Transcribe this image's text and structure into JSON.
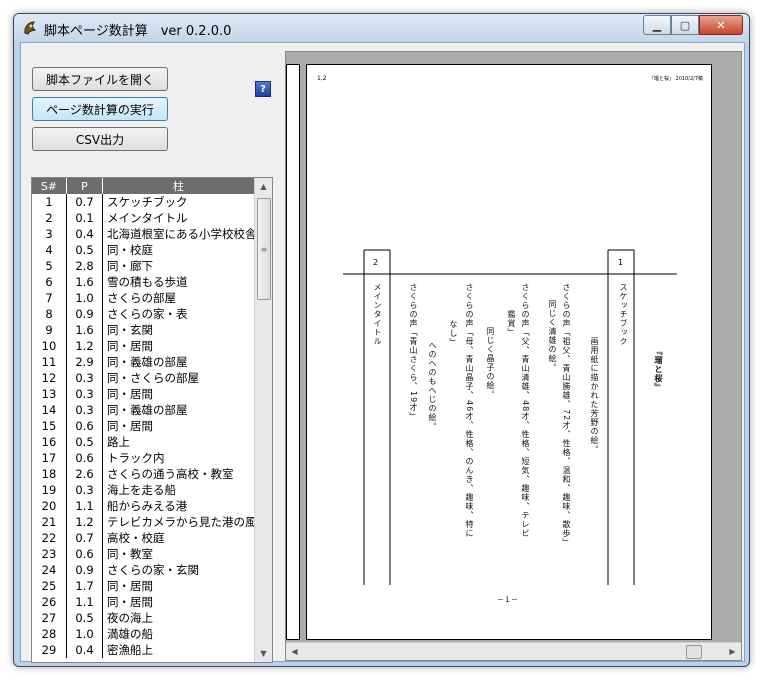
{
  "window": {
    "title": "脚本ページ数計算　ver 0.2.0.0"
  },
  "toolbar": {
    "open_label": "脚本ファイルを開く",
    "calc_label": "ページ数計算の実行",
    "csv_label": "CSV出力",
    "help_label": "?"
  },
  "table": {
    "headers": [
      "S#",
      "P",
      "柱"
    ],
    "rows": [
      [
        "1",
        "0.7",
        "スケッチブック"
      ],
      [
        "2",
        "0.1",
        "メインタイトル"
      ],
      [
        "3",
        "0.4",
        "北海道根室にある小学校校舎"
      ],
      [
        "4",
        "0.5",
        "同・校庭"
      ],
      [
        "5",
        "2.8",
        "同・廊下"
      ],
      [
        "6",
        "1.6",
        "雪の積もる歩道"
      ],
      [
        "7",
        "1.0",
        "さくらの部屋"
      ],
      [
        "8",
        "0.9",
        "さくらの家・表"
      ],
      [
        "9",
        "1.6",
        "同・玄関"
      ],
      [
        "10",
        "1.2",
        "同・居間"
      ],
      [
        "11",
        "2.9",
        "同・義雄の部屋"
      ],
      [
        "12",
        "0.3",
        "同・さくらの部屋"
      ],
      [
        "13",
        "0.3",
        "同・居間"
      ],
      [
        "14",
        "0.3",
        "同・義雄の部屋"
      ],
      [
        "15",
        "0.6",
        "同・居間"
      ],
      [
        "16",
        "0.5",
        "路上"
      ],
      [
        "17",
        "0.6",
        "トラック内"
      ],
      [
        "18",
        "2.6",
        "さくらの通う高校・教室"
      ],
      [
        "19",
        "0.3",
        "海上を走る船"
      ],
      [
        "20",
        "1.1",
        "船からみえる港"
      ],
      [
        "21",
        "1.2",
        "テレビカメラから見た港の風景"
      ],
      [
        "22",
        "0.7",
        "高校・校庭"
      ],
      [
        "23",
        "0.6",
        "同・教室"
      ],
      [
        "24",
        "0.9",
        "さくらの家・玄関"
      ],
      [
        "25",
        "1.7",
        "同・居間"
      ],
      [
        "26",
        "1.1",
        "同・居間"
      ],
      [
        "27",
        "0.5",
        "夜の海上"
      ],
      [
        "28",
        "1.0",
        "満雄の船"
      ],
      [
        "29",
        "0.4",
        "密漁船上"
      ]
    ]
  },
  "preview": {
    "page_label": "1,2",
    "header_right": "『瑠と桜』 2010/2/7稿",
    "scene_no_1": "1",
    "scene_no_2": "2",
    "scene1_slug": "スケッチブック",
    "scene2_slug": "メインタイトル",
    "title_line": "『瑠と桜』",
    "lines": [
      "画用紙に描かれた芳野の絵。",
      "さくらの声「祖父、青山勝雄、72才、性格、温和、趣味、散歩」",
      "同じく清雄の絵。",
      "さくらの声「父、青山清雄、48才、性格、短気、趣味、テレビ",
      "鑑賞」",
      "同じく晶子の絵。",
      "さくらの声「母、青山晶子、46才、性格、のんき、趣味、特に",
      "なし」",
      "へのへのもへじの絵。",
      "さくらの声「青山さくら、19才」"
    ],
    "footer": "－１－"
  }
}
